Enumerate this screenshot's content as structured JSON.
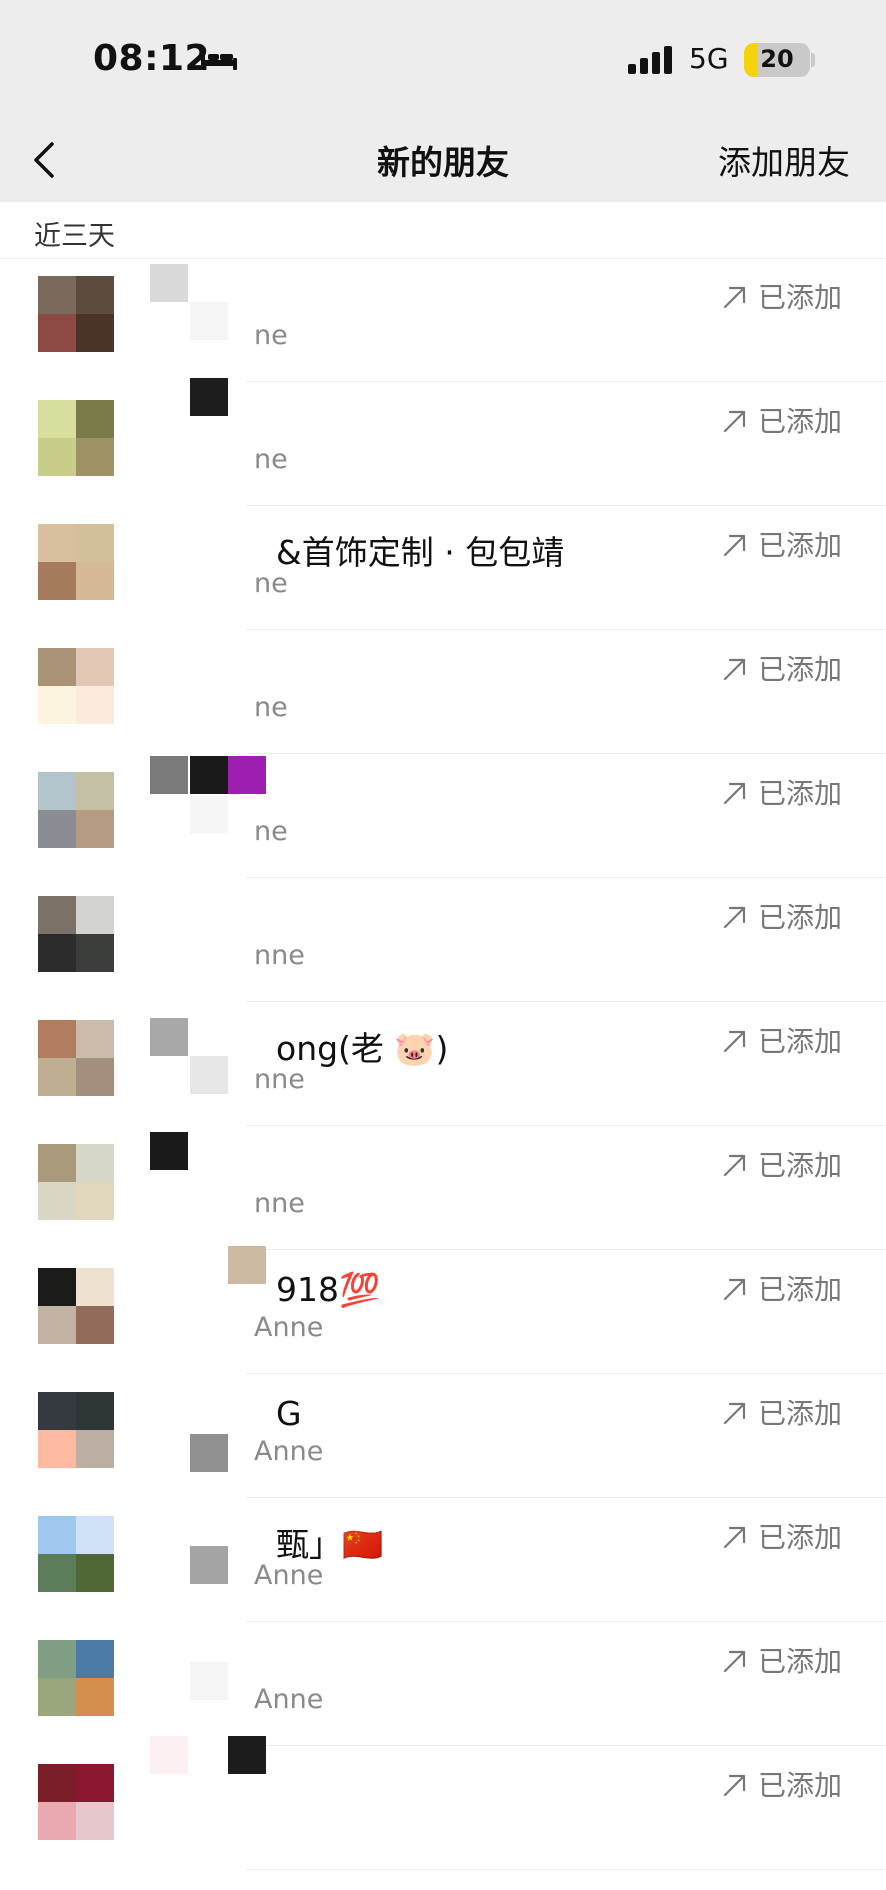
{
  "status_bar": {
    "time": "08:12",
    "network": "5G",
    "battery": "20",
    "battery_level": 0.2
  },
  "nav": {
    "title": "新的朋友",
    "add_friend": "添加朋友"
  },
  "section": {
    "label": "近三天"
  },
  "friends": [
    {
      "name": "",
      "remark": "ne",
      "action": "已添加",
      "avatar": [
        "#7a6a5e",
        "#5c4c40",
        "#8d4a44",
        "#4a3428"
      ]
    },
    {
      "name": "",
      "remark": "ne",
      "action": "已添加",
      "avatar": [
        "#d8df9e",
        "#7b7b4a",
        "#c9cd8a",
        "#9e9264"
      ]
    },
    {
      "name": "&首饰定制 · 包包靖",
      "remark": "ne",
      "action": "已添加",
      "avatar": [
        "#d8bf9e",
        "#d4bf9b",
        "#a57b5c",
        "#d5b896"
      ]
    },
    {
      "name": "",
      "remark": "ne",
      "action": "已添加",
      "avatar": [
        "#a99275",
        "#e2c8b4",
        "#fdf4e0",
        "#fbebdd"
      ]
    },
    {
      "name": "",
      "remark": "ne",
      "action": "已添加",
      "avatar": [
        "#b4c4cc",
        "#c4c0a5",
        "#8a8d94",
        "#b59c83"
      ]
    },
    {
      "name": "",
      "remark": "nne",
      "action": "已添加",
      "avatar": [
        "#7a7267",
        "#d2d3cf",
        "#2c2c2c",
        "#3a3d3a"
      ]
    },
    {
      "name": "ong(老 🐷)",
      "remark": "nne",
      "action": "已添加",
      "avatar": [
        "#b07e5e",
        "#cbbbaa",
        "#bfae92",
        "#a48e7c"
      ]
    },
    {
      "name": "",
      "remark": "nne",
      "action": "已添加",
      "avatar": [
        "#a99a7c",
        "#d9d7ca",
        "#dbd7c6",
        "#e0d7bc"
      ]
    },
    {
      "name": "918💯",
      "remark": "Anne",
      "action": "已添加",
      "avatar": [
        "#1b1b19",
        "#efe1d0",
        "#c3b3a2",
        "#926c5a"
      ]
    },
    {
      "name": "G",
      "remark": "Anne",
      "action": "已添加",
      "avatar": [
        "#343a40",
        "#2f3638",
        "#fdbaa0",
        "#bcaea2"
      ]
    },
    {
      "name": "甄」🇨🇳",
      "remark": "Anne",
      "action": "已添加",
      "avatar": [
        "#9fc8ee",
        "#cfe2f7",
        "#5b7c58",
        "#4f6636"
      ]
    },
    {
      "name": "",
      "remark": "Anne",
      "action": "已添加",
      "avatar": [
        "#7f9e84",
        "#4b7ba6",
        "#9aa67c",
        "#d48e4e"
      ]
    },
    {
      "name": "",
      "remark": "",
      "action": "已添加",
      "avatar": [
        "#7a1e2a",
        "#8c1530",
        "#e8aab0",
        "#e6c8cc"
      ]
    }
  ]
}
